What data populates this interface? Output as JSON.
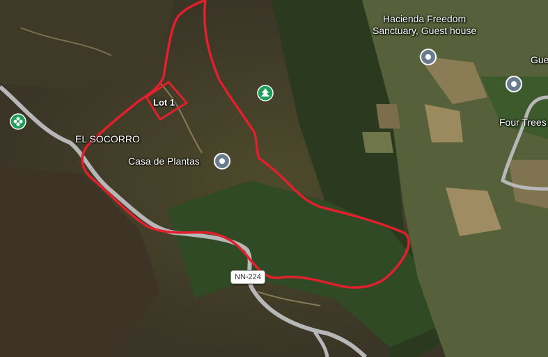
{
  "places": {
    "hacienda_line1": "Hacienda Freedom",
    "hacienda_line2": "Sanctuary, Guest house",
    "guest_partial": "Gue",
    "four_trees": "Four Trees",
    "el_socorro": "EL SOCORRO",
    "casa_de_plantas": "Casa de Plantas",
    "lot1": "Lot 1"
  },
  "road_shield": "NN-224",
  "colors": {
    "boundary": "#e0202c",
    "poi_pin": "#6b7d8c",
    "park_icon": "#1e9e5a",
    "road": "#b7b7b7"
  },
  "icons": [
    "pin-icon",
    "tree-icon",
    "flower-poi-icon"
  ]
}
